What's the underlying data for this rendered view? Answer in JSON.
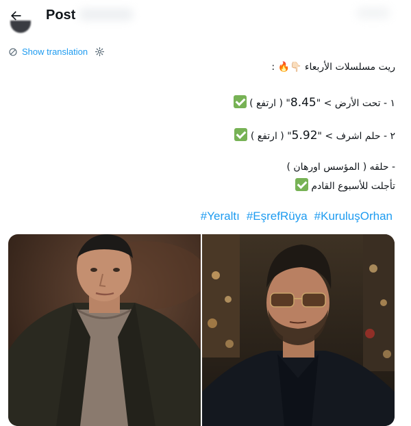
{
  "header": {
    "title": "Post",
    "back_icon": "arrow-left-icon"
  },
  "translation": {
    "label": "Show translation",
    "icon": "translate-icon",
    "settings_icon": "gear-icon"
  },
  "tweet": {
    "line1_text": "ريت مسلسلات الأربعاء",
    "line1_emoji": "👇🏻🔥",
    "line1_suffix": ":",
    "line2_prefix": "١ - تحت الأرض",
    "line2_value": "8.45",
    "line2_suffix": "( ارتفع )",
    "line3_prefix": "٢ - حلم اشرف",
    "line3_value": "5.92",
    "line3_suffix": "( ارتفع )",
    "line4": "- حلقه ( المؤسس اورهان )",
    "line5": "تأجلت للأسبوع القادم",
    "accent": "#1d9bf0"
  },
  "hashtags": [
    "#Yeraltı",
    "#EşrefRüya",
    "#KuruluşOrhan"
  ],
  "media": {
    "left_alt": "man in dark jacket",
    "right_alt": "man in sunglasses at night"
  }
}
